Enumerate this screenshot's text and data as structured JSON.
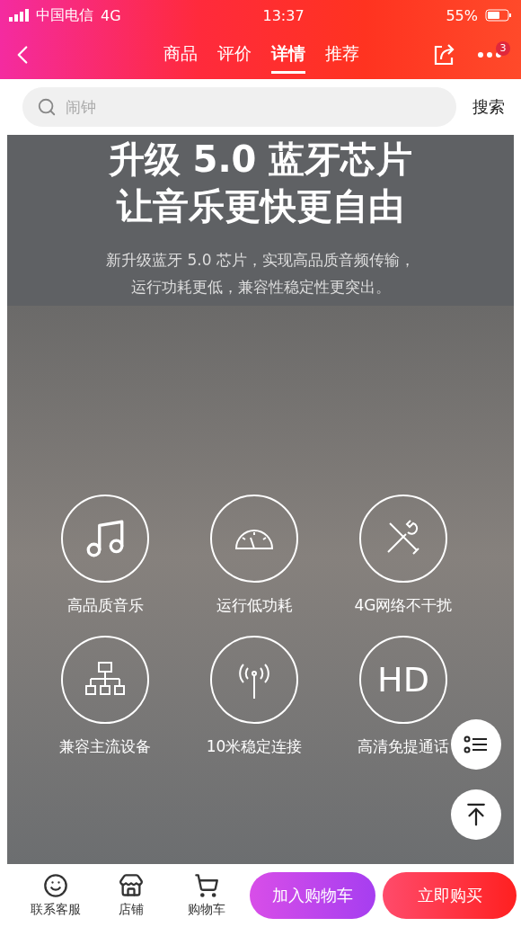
{
  "status_bar": {
    "carrier": "中国电信",
    "network": "4G",
    "time": "13:37",
    "battery": "55%"
  },
  "nav": {
    "tabs": [
      {
        "label": "商品",
        "selected": false
      },
      {
        "label": "评价",
        "selected": false
      },
      {
        "label": "详情",
        "selected": true
      },
      {
        "label": "推荐",
        "selected": false
      }
    ],
    "more_badge": "3"
  },
  "search": {
    "placeholder": "闹钟",
    "button": "搜索"
  },
  "detail": {
    "headline": [
      "升级 5.0 蓝牙芯片",
      "让音乐更快更自由"
    ],
    "description": [
      "新升级蓝牙 5.0 芯片，实现高品质音频传输，",
      "运行功耗更低，兼容性稳定性更突出。"
    ],
    "features": [
      {
        "kind": "music",
        "label": "高品质音乐"
      },
      {
        "kind": "gauge",
        "label": "运行低功耗"
      },
      {
        "kind": "tools",
        "label": "4G网络不干扰"
      },
      {
        "kind": "network",
        "label": "兼容主流设备"
      },
      {
        "kind": "antenna",
        "label": "10米稳定连接"
      },
      {
        "kind": "text",
        "icon_text": "HD",
        "label": "高清免提通话"
      }
    ]
  },
  "bottom_bar": {
    "items": [
      {
        "kind": "service",
        "label": "联系客服"
      },
      {
        "kind": "store",
        "label": "店铺"
      },
      {
        "kind": "cart",
        "label": "购物车"
      }
    ],
    "buttons": [
      {
        "kind": "add",
        "label": "加入购物车"
      },
      {
        "kind": "buy",
        "label": "立即购买"
      }
    ]
  }
}
